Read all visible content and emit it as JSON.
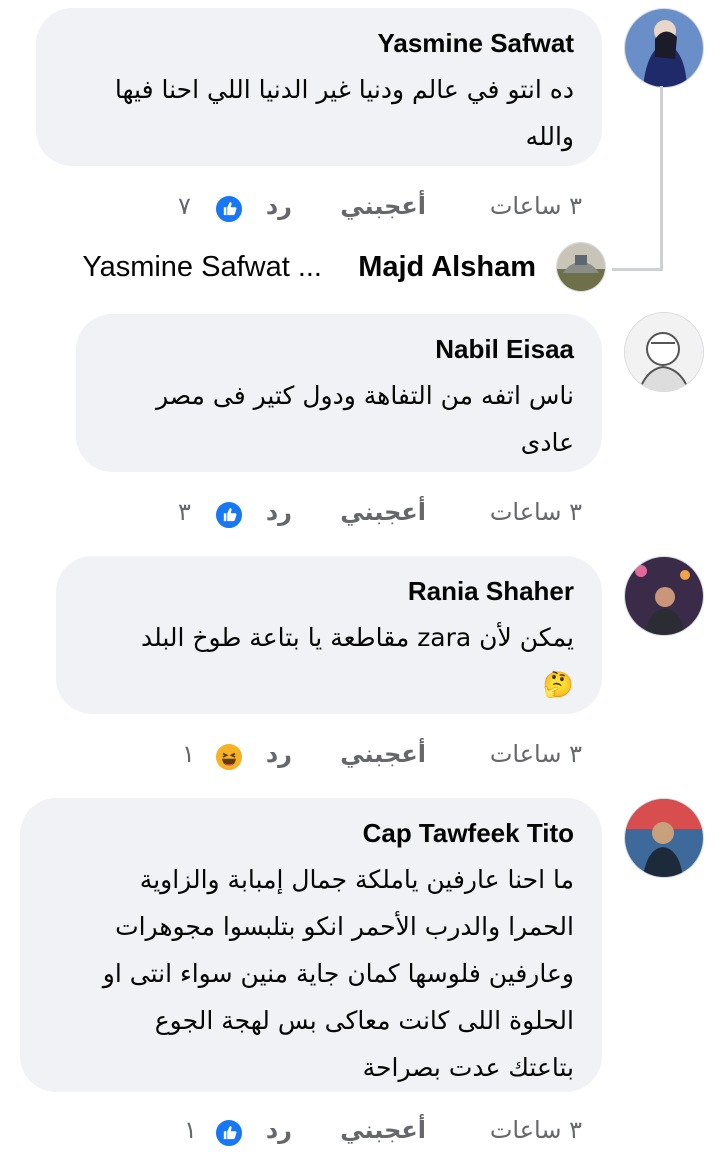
{
  "comments": [
    {
      "author": "Yasmine Safwat",
      "text": "ده انتو في عالم ودنيا غير الدنيا اللي احنا فيها\nوالله",
      "time": "٣ ساعات",
      "like_label": "أعجبني",
      "reply_label": "رد",
      "reaction": "like-icon",
      "reaction_count": "٧"
    },
    {
      "author": "Nabil Eisaa",
      "text": "ناس اتفه من التفاهة ودول كتير فى مصر\nعادى",
      "time": "٣ ساعات",
      "like_label": "أعجبني",
      "reply_label": "رد",
      "reaction": "like-icon",
      "reaction_count": "٣"
    },
    {
      "author": "Rania Shaher",
      "text": "يمكن لأن zara مقاطعة يا بتاعة طوخ البلد\n🤔",
      "time": "٣ ساعات",
      "like_label": "أعجبني",
      "reply_label": "رد",
      "reaction": "haha-icon",
      "reaction_count": "١"
    },
    {
      "author": "Cap Tawfeek Tito",
      "text": "ما احنا عارفين ياملكة جمال إمبابة والزاوية\nالحمرا والدرب الأحمر انكو بتلبسوا مجوهرات\nوعارفين فلوسها كمان جاية منين سواء انتى او\nالحلوة اللى كانت معاكى بس لهجة الجوع\nبتاعتك عدت بصراحة",
      "time": "٣ ساعات",
      "like_label": "أعجبني",
      "reply_label": "رد",
      "reaction": "like-icon",
      "reaction_count": "١"
    }
  ],
  "reply_thread": {
    "author": "Majd Alsham",
    "preview": "Yasmine Safwat ..."
  },
  "colors": {
    "bubble": "#f0f2f5",
    "meta_text": "#65676b",
    "like_blue": "#1877f2",
    "haha_yellow": "#f7b125",
    "thread_line": "#ced0d4"
  }
}
